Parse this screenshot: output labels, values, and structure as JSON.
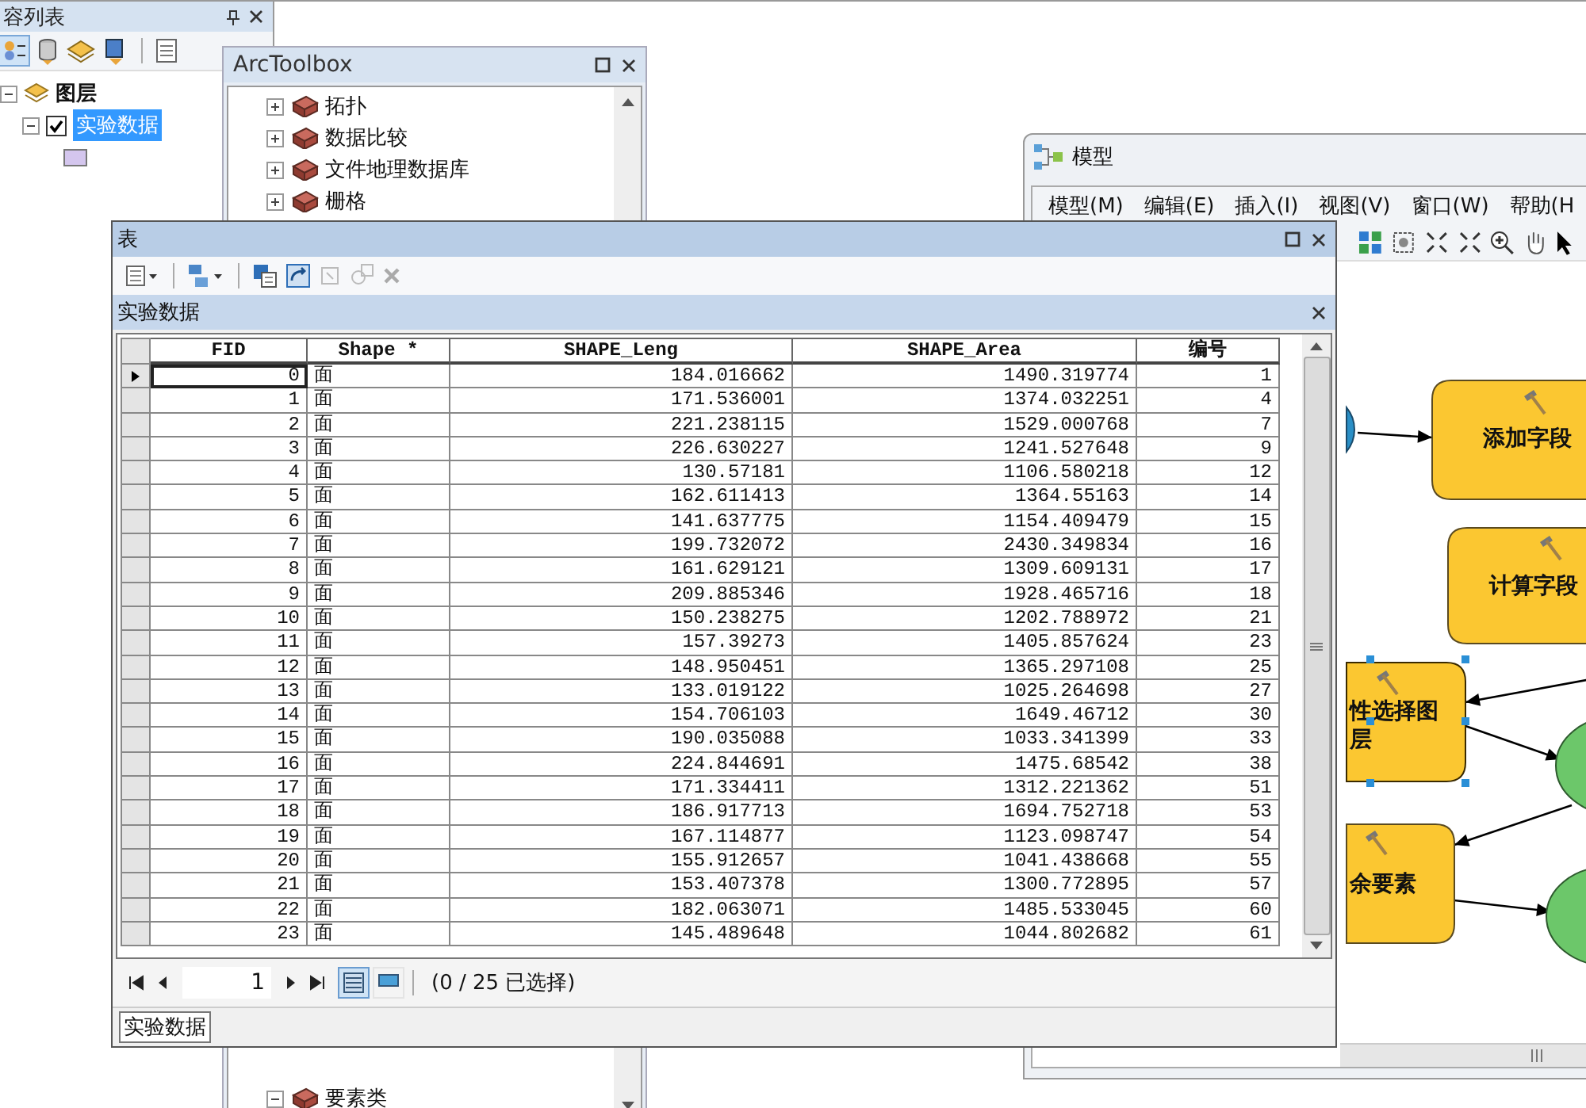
{
  "toc": {
    "title": "容列表",
    "group": {
      "label": "图层",
      "expanded": true,
      "children": [
        {
          "label": "实验数据",
          "checked": true,
          "selected": true,
          "expanded": true
        }
      ]
    }
  },
  "toolbox": {
    "title": "ArcToolbox",
    "items": [
      {
        "label": "拓扑",
        "expanded": false
      },
      {
        "label": "数据比较",
        "expanded": false
      },
      {
        "label": "文件地理数据库",
        "expanded": false
      },
      {
        "label": "栅格",
        "expanded": false
      }
    ],
    "lower_items": [
      {
        "label": "要素类",
        "expanded": true
      }
    ]
  },
  "model": {
    "title": "模型",
    "menu": [
      "模型(M)",
      "编辑(E)",
      "插入(I)",
      "视图(V)",
      "窗口(W)",
      "帮助(H"
    ],
    "nodes": [
      {
        "kind": "input"
      },
      {
        "kind": "tool",
        "lines": [
          "添加字段"
        ],
        "selected": false
      },
      {
        "kind": "tool",
        "lines": [
          "计算字段"
        ],
        "selected": false
      },
      {
        "kind": "tool",
        "lines": [
          "性选择图",
          "层"
        ],
        "selected": true
      },
      {
        "kind": "tool",
        "lines": [
          "余要素"
        ],
        "selected": false
      },
      {
        "kind": "output"
      },
      {
        "kind": "output"
      }
    ]
  },
  "table": {
    "title": "表",
    "tab": "实验数据",
    "columns": [
      "FID",
      "Shape *",
      "SHAPE_Leng",
      "SHAPE_Area",
      "编号"
    ],
    "rows": [
      {
        "current": true,
        "cells": [
          "0",
          "面",
          "184.016662",
          "1490.319774",
          "1"
        ]
      },
      {
        "current": false,
        "cells": [
          "1",
          "面",
          "171.536001",
          "1374.032251",
          "4"
        ]
      },
      {
        "current": false,
        "cells": [
          "2",
          "面",
          "221.238115",
          "1529.000768",
          "7"
        ]
      },
      {
        "current": false,
        "cells": [
          "3",
          "面",
          "226.630227",
          "1241.527648",
          "9"
        ]
      },
      {
        "current": false,
        "cells": [
          "4",
          "面",
          "130.57181",
          "1106.580218",
          "12"
        ]
      },
      {
        "current": false,
        "cells": [
          "5",
          "面",
          "162.611413",
          "1364.55163",
          "14"
        ]
      },
      {
        "current": false,
        "cells": [
          "6",
          "面",
          "141.637775",
          "1154.409479",
          "15"
        ]
      },
      {
        "current": false,
        "cells": [
          "7",
          "面",
          "199.732072",
          "2430.349834",
          "16"
        ]
      },
      {
        "current": false,
        "cells": [
          "8",
          "面",
          "161.629121",
          "1309.609131",
          "17"
        ]
      },
      {
        "current": false,
        "cells": [
          "9",
          "面",
          "209.885346",
          "1928.465716",
          "18"
        ]
      },
      {
        "current": false,
        "cells": [
          "10",
          "面",
          "150.238275",
          "1202.788972",
          "21"
        ]
      },
      {
        "current": false,
        "cells": [
          "11",
          "面",
          "157.39273",
          "1405.857624",
          "23"
        ]
      },
      {
        "current": false,
        "cells": [
          "12",
          "面",
          "148.950451",
          "1365.297108",
          "25"
        ]
      },
      {
        "current": false,
        "cells": [
          "13",
          "面",
          "133.019122",
          "1025.264698",
          "27"
        ]
      },
      {
        "current": false,
        "cells": [
          "14",
          "面",
          "154.706103",
          "1649.46712",
          "30"
        ]
      },
      {
        "current": false,
        "cells": [
          "15",
          "面",
          "190.035088",
          "1033.341399",
          "33"
        ]
      },
      {
        "current": false,
        "cells": [
          "16",
          "面",
          "224.844691",
          "1475.68542",
          "38"
        ]
      },
      {
        "current": false,
        "cells": [
          "17",
          "面",
          "171.334411",
          "1312.221362",
          "51"
        ]
      },
      {
        "current": false,
        "cells": [
          "18",
          "面",
          "186.917713",
          "1694.752718",
          "53"
        ]
      },
      {
        "current": false,
        "cells": [
          "19",
          "面",
          "167.114877",
          "1123.098747",
          "54"
        ]
      },
      {
        "current": false,
        "cells": [
          "20",
          "面",
          "155.912657",
          "1041.438668",
          "55"
        ]
      },
      {
        "current": false,
        "cells": [
          "21",
          "面",
          "153.407378",
          "1300.772895",
          "57"
        ]
      },
      {
        "current": false,
        "cells": [
          "22",
          "面",
          "182.063071",
          "1485.533045",
          "60"
        ]
      },
      {
        "current": false,
        "cells": [
          "23",
          "面",
          "145.489648",
          "1044.802682",
          "61"
        ]
      }
    ],
    "page": "1",
    "views": [
      {
        "selected": true
      },
      {
        "selected": false
      }
    ],
    "selection_status": "(0 / 25 已选择)",
    "bottom_tab": "实验数据"
  }
}
